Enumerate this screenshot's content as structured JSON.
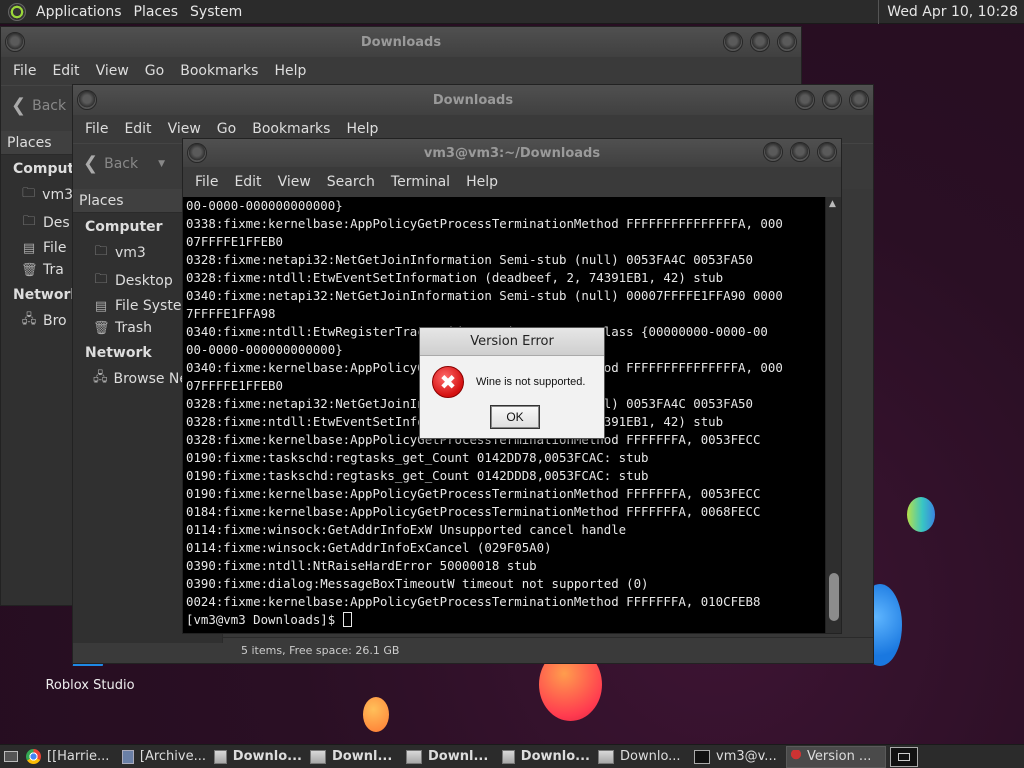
{
  "top_panel": {
    "menus": [
      "Applications",
      "Places",
      "System"
    ],
    "clock": "Wed Apr 10, 10:28"
  },
  "file_manager_back": {
    "title": "Downloads",
    "menu": [
      "File",
      "Edit",
      "View",
      "Go",
      "Bookmarks",
      "Help"
    ],
    "back_label": "Back",
    "places_label": "Places",
    "computer_label": "Compute",
    "items": [
      "vm3",
      "Des",
      "File",
      "Tra"
    ],
    "network_label": "Network",
    "network_item": "Bro"
  },
  "file_manager_front": {
    "title": "Downloads",
    "menu": [
      "File",
      "Edit",
      "View",
      "Go",
      "Bookmarks",
      "Help"
    ],
    "back_label": "Back",
    "places_label": "Places",
    "computer_label": "Computer",
    "items": [
      "vm3",
      "Desktop",
      "File System",
      "Trash"
    ],
    "network_label": "Network",
    "network_item": "Browse Network",
    "status": "5 items, Free space: 26.1 GB"
  },
  "terminal": {
    "title": "vm3@vm3:~/Downloads",
    "menu": [
      "File",
      "Edit",
      "View",
      "Search",
      "Terminal",
      "Help"
    ],
    "lines": [
      "00-0000-000000000000}",
      "0338:fixme:kernelbase:AppPolicyGetProcessTerminationMethod FFFFFFFFFFFFFFFA, 000",
      "07FFFFE1FFEB0",
      "0328:fixme:netapi32:NetGetJoinInformation Semi-stub (null) 0053FA4C 0053FA50",
      "0328:fixme:ntdll:EtwEventSetInformation (deadbeef, 2, 74391EB1, 42) stub",
      "0340:fixme:netapi32:NetGetJoinInformation Semi-stub (null) 00007FFFFE1FFA90 0000",
      "7FFFFE1FFA98",
      "0340:fixme:ntdll:EtwRegisterTraceGuidsW register trace class {00000000-0000-00",
      "00-0000-000000000000}",
      "0340:fixme:kernelbase:AppPolicyGetProcessTerminationMethod FFFFFFFFFFFFFFFA, 000",
      "07FFFFE1FFEB0",
      "0328:fixme:netapi32:NetGetJoinInformation Semi-stub (null) 0053FA4C 0053FA50",
      "0328:fixme:ntdll:EtwEventSetInformation (deadbeef, 2, 74391EB1, 42) stub",
      "0328:fixme:kernelbase:AppPolicyGetProcessTerminationMethod FFFFFFFA, 0053FECC",
      "0190:fixme:taskschd:regtasks_get_Count 0142DD78,0053FCAC: stub",
      "0190:fixme:taskschd:regtasks_get_Count 0142DDD8,0053FCAC: stub",
      "0190:fixme:kernelbase:AppPolicyGetProcessTerminationMethod FFFFFFFA, 0053FECC",
      "0184:fixme:kernelbase:AppPolicyGetProcessTerminationMethod FFFFFFFA, 0068FECC",
      "0114:fixme:winsock:GetAddrInfoExW Unsupported cancel handle",
      "0114:fixme:winsock:GetAddrInfoExCancel (029F05A0)",
      "0390:fixme:ntdll:NtRaiseHardError 50000018 stub",
      "0390:fixme:dialog:MessageBoxTimeoutW timeout not supported (0)",
      "0024:fixme:kernelbase:AppPolicyGetProcessTerminationMethod FFFFFFFA, 010CFEB8"
    ],
    "prompt": "[vm3@vm3 Downloads]$ "
  },
  "dialog": {
    "title": "Version Error",
    "message": "Wine is not supported.",
    "ok_label": "OK"
  },
  "desktop_icon": {
    "label": "Roblox Studio"
  },
  "taskbar": {
    "tasks": [
      {
        "label": "[[Harrie...",
        "icon": "chrome-icon",
        "bold": false
      },
      {
        "label": "[Archive...",
        "icon": "app-icon",
        "bold": false
      },
      {
        "label": "Downlo...",
        "icon": "folder-icon",
        "bold": true
      },
      {
        "label": "Downl...",
        "icon": "folder-icon",
        "bold": true
      },
      {
        "label": "Downl...",
        "icon": "folder-icon",
        "bold": true
      },
      {
        "label": "Downlo...",
        "icon": "folder-icon",
        "bold": true
      },
      {
        "label": "Downlo...",
        "icon": "folder-icon",
        "bold": false
      },
      {
        "label": "vm3@v...",
        "icon": "terminal-icon",
        "bold": false
      },
      {
        "label": "Version ...",
        "icon": "wine-icon",
        "bold": false
      }
    ]
  }
}
